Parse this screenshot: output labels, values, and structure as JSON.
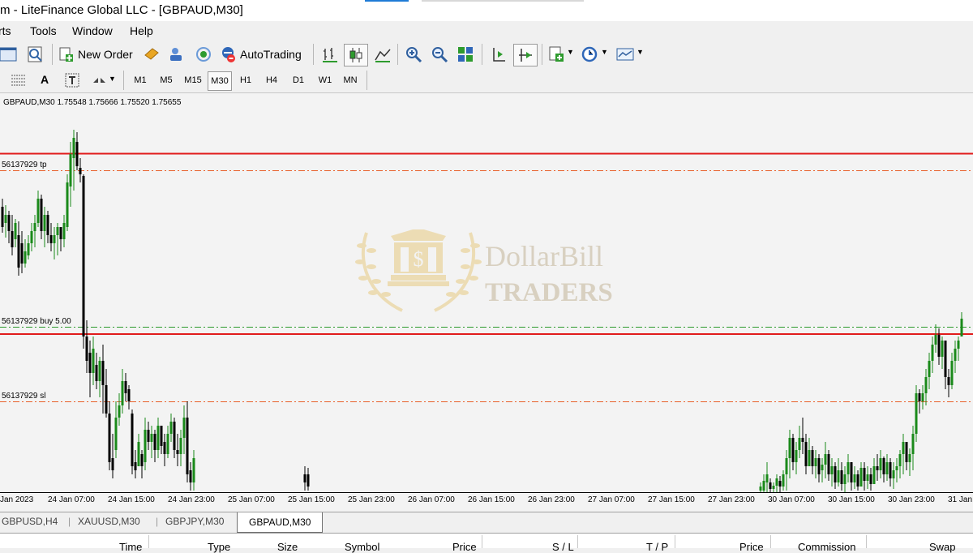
{
  "window": {
    "title": "m - LiteFinance Global LLC - [GBPAUD,M30]"
  },
  "menu": {
    "items": [
      "rts",
      "Tools",
      "Window",
      "Help"
    ]
  },
  "toolbar": {
    "new_order_label": "New Order",
    "autotrading_label": "AutoTrading"
  },
  "timeframes": {
    "items": [
      "M1",
      "M5",
      "M15",
      "M30",
      "H1",
      "H4",
      "D1",
      "W1",
      "MN"
    ],
    "selected": "M30"
  },
  "chart": {
    "header": "GBPAUD,M30  1.75548 1.75666 1.75520 1.75655",
    "tp_label": "56137929 tp",
    "buy_label": "56137929 buy 5.00",
    "sl_label": "56137929 sl",
    "colors": {
      "bull": "#1a8a1a",
      "bear": "#000000",
      "level_line": "#e11b1b",
      "stop_line": "#e8602a",
      "buy_line": "#2c9a2c"
    }
  },
  "time_axis": {
    "labels": [
      "Jan 2023",
      "24 Jan 07:00",
      "24 Jan 15:00",
      "24 Jan 23:00",
      "25 Jan 07:00",
      "25 Jan 15:00",
      "25 Jan 23:00",
      "26 Jan 07:00",
      "26 Jan 15:00",
      "26 Jan 23:00",
      "27 Jan 07:00",
      "27 Jan 15:00",
      "27 Jan 23:00",
      "30 Jan 07:00",
      "30 Jan 15:00",
      "30 Jan 23:00",
      "31 Jan"
    ]
  },
  "watermark": {
    "line1": "DollarBill",
    "line2": "TRADERS"
  },
  "tabs": {
    "items": [
      "GBPUSD,H4",
      "XAUUSD,M30",
      "GBPJPY,M30",
      "GBPAUD,M30"
    ],
    "active": "GBPAUD,M30"
  },
  "terminal": {
    "columns": [
      "Time",
      "Type",
      "Size",
      "Symbol",
      "Price",
      "S / L",
      "T / P",
      "Price",
      "Commission",
      "Swap"
    ]
  }
}
